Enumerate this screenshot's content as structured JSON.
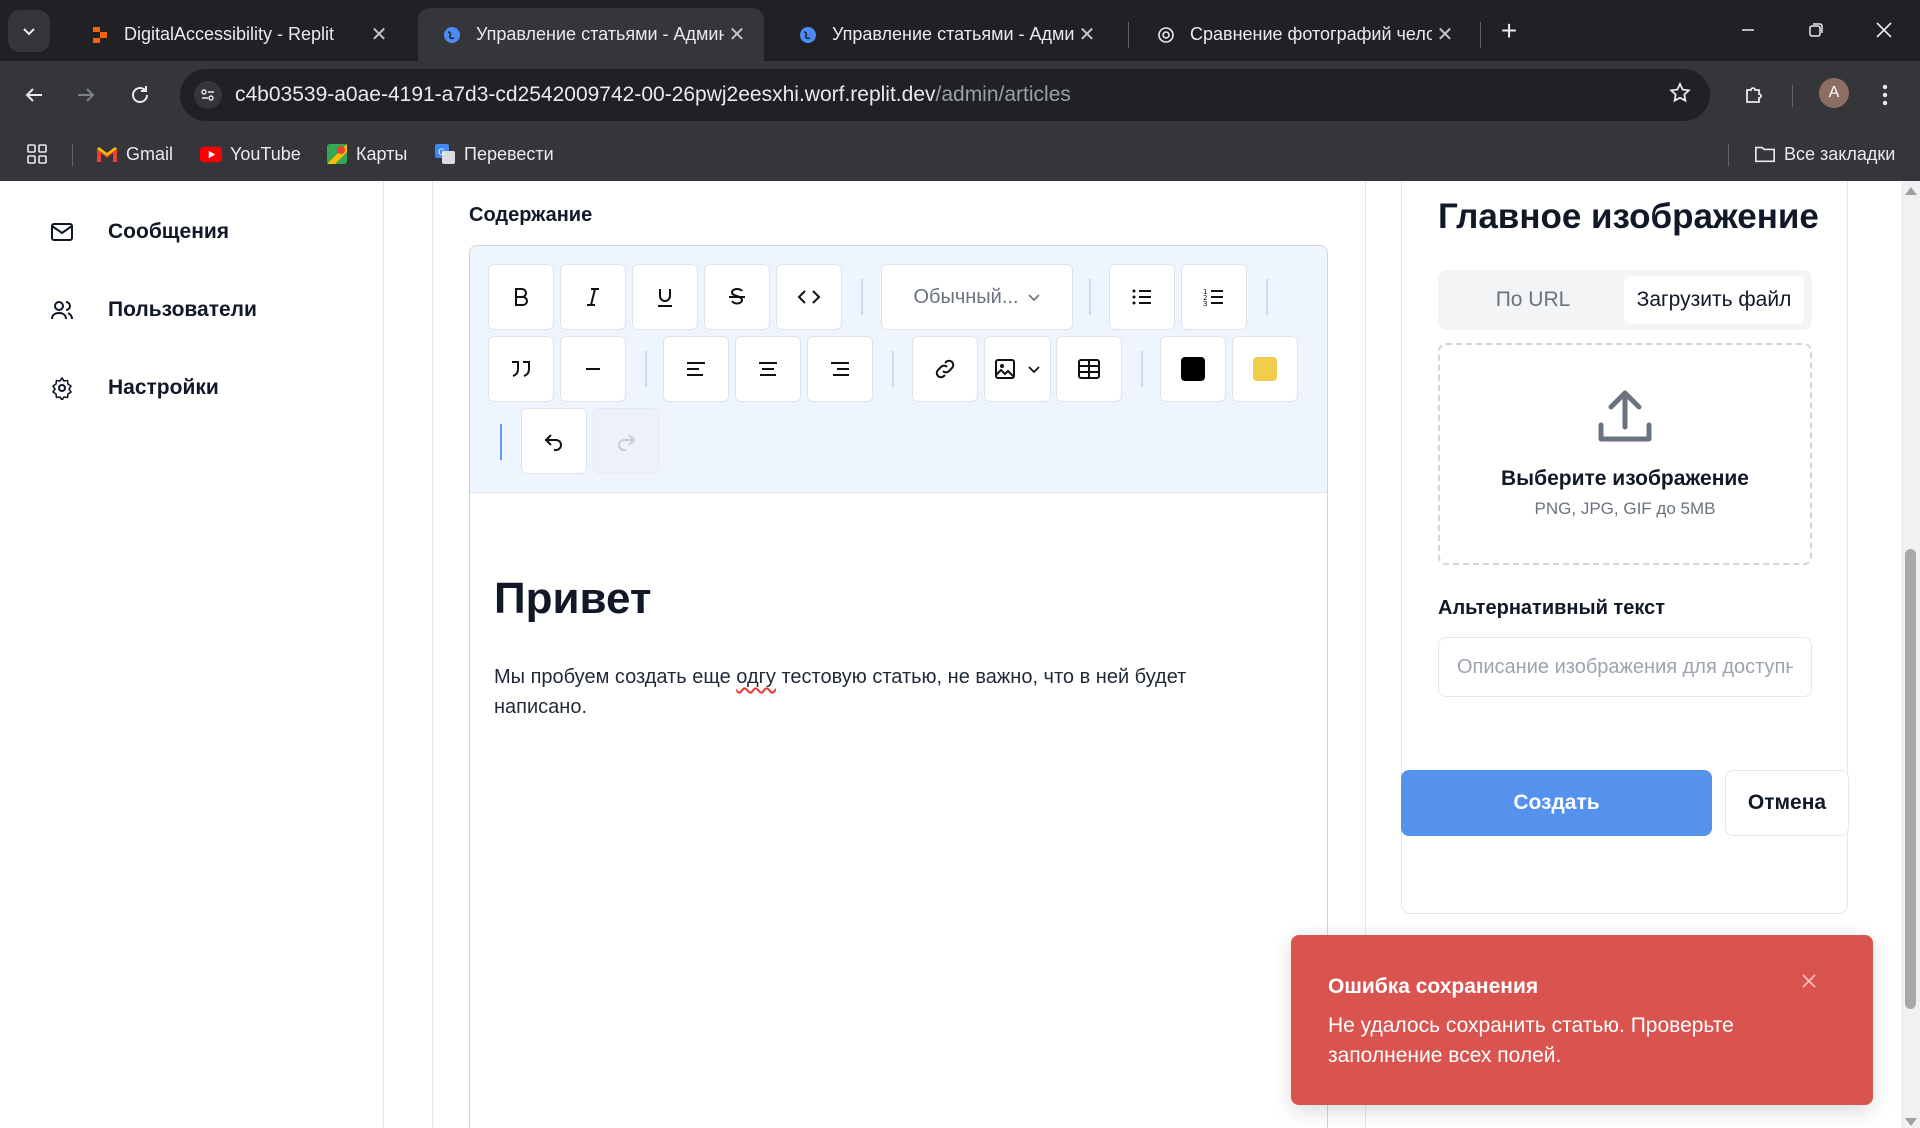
{
  "browser": {
    "tabs": [
      {
        "title": "DigitalAccessibility - Replit",
        "favicon": "replit-icon"
      },
      {
        "title": "Управление статьями - Админ",
        "favicon": "globe-icon",
        "active": true
      },
      {
        "title": "Управление статьями - Админ",
        "favicon": "globe-icon"
      },
      {
        "title": "Сравнение фотографий челов",
        "favicon": "openai-icon"
      }
    ],
    "url_host": "c4b03539-a0ae-4191-a7d3-cd2542009742-00-26pwj2eesxhi.worf.replit.dev",
    "url_path": "/admin/articles",
    "profile_initial": "A",
    "bookmarks": [
      {
        "label": "Gmail",
        "icon": "gmail-icon"
      },
      {
        "label": "YouTube",
        "icon": "youtube-icon"
      },
      {
        "label": "Карты",
        "icon": "maps-icon"
      },
      {
        "label": "Перевести",
        "icon": "translate-icon"
      }
    ],
    "all_bookmarks_label": "Все закладки"
  },
  "sidebar": {
    "items": [
      {
        "label": "Сообщения",
        "icon": "mail-icon"
      },
      {
        "label": "Пользователи",
        "icon": "users-icon"
      },
      {
        "label": "Настройки",
        "icon": "gear-icon"
      }
    ]
  },
  "editor": {
    "section_label": "Содержание",
    "block_type": "Обычный...",
    "text_color": "#000000",
    "highlight_color": "#f0cd4c",
    "heading": "Привет",
    "paragraph_before": "Мы пробуем создать еще ",
    "paragraph_misspelled": "одгу",
    "paragraph_after": " тестовую статью, не важно, что в ней будет написано."
  },
  "image_panel": {
    "title": "Главное изображение",
    "tab_url": "По URL",
    "tab_file": "Загрузить файл",
    "upload_title": "Выберите изображение",
    "upload_hint": "PNG, JPG, GIF до 5MB",
    "alt_label": "Альтернативный текст",
    "alt_placeholder": "Описание изображения для доступности"
  },
  "actions": {
    "create_label": "Создать",
    "cancel_label": "Отмена",
    "create_color": "#5592ed"
  },
  "toast": {
    "title": "Ошибка сохранения",
    "message": "Не удалось сохранить статью. Проверьте заполнение всех полей.",
    "color": "#d9534f"
  }
}
